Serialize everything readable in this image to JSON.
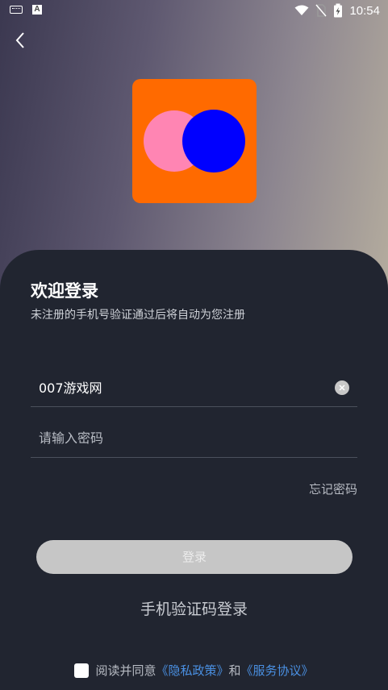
{
  "status_bar": {
    "time": "10:54"
  },
  "logo": {
    "bg_color": "#ff6a00",
    "circle_left_color": "#ff85b3",
    "circle_right_color": "#0000ff"
  },
  "login": {
    "title": "欢迎登录",
    "subtitle": "未注册的手机号验证通过后将自动为您注册",
    "username_value": "007游戏网",
    "password_placeholder": "请输入密码",
    "forgot_password": "忘记密码",
    "login_button": "登录",
    "sms_login": "手机验证码登录"
  },
  "agreement": {
    "prefix": "阅读并同意",
    "privacy": "《隐私政策》",
    "and": "和",
    "service": "《服务协议》"
  }
}
